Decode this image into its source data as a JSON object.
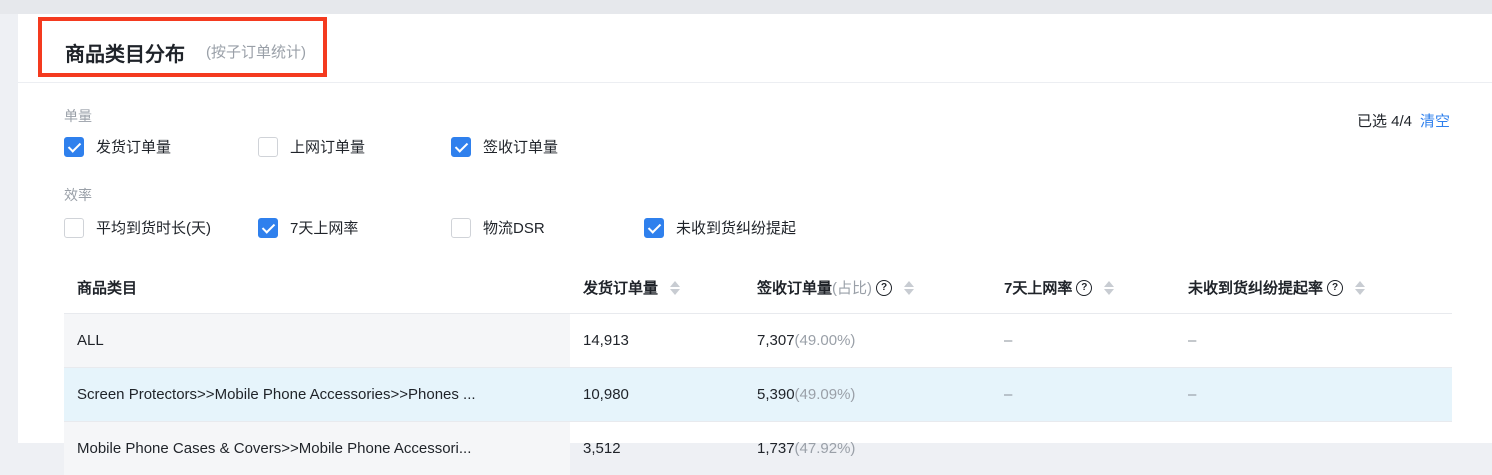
{
  "header": {
    "title": "商品类目分布",
    "subtitle": "(按子订单统计)"
  },
  "filters": {
    "group1_label": "单量",
    "group1": [
      {
        "label": "发货订单量",
        "checked": true
      },
      {
        "label": "上网订单量",
        "checked": false
      },
      {
        "label": "签收订单量",
        "checked": true
      }
    ],
    "group2_label": "效率",
    "group2": [
      {
        "label": "平均到货时长(天)",
        "checked": false
      },
      {
        "label": "7天上网率",
        "checked": true
      },
      {
        "label": "物流DSR",
        "checked": false
      },
      {
        "label": "未收到货纠纷提起",
        "checked": true
      }
    ],
    "selected_text": "已选 4/4",
    "clear_label": "清空"
  },
  "table": {
    "columns": {
      "category": "商品类目",
      "shipped": "发货订单量",
      "signed": "签收订单量",
      "signed_ratio_suffix": "(占比)",
      "online_rate": "7天上网率",
      "dispute_rate": "未收到货纠纷提起率"
    },
    "rows": [
      {
        "category": "ALL",
        "shipped": "14,913",
        "signed": "7,307",
        "signed_pct": "(49.00%)",
        "online_rate": "–",
        "dispute_rate": "–"
      },
      {
        "category": "Screen Protectors>>Mobile Phone Accessories>>Phones ...",
        "shipped": "10,980",
        "signed": "5,390",
        "signed_pct": "(49.09%)",
        "online_rate": "–",
        "dispute_rate": "–"
      },
      {
        "category": "Mobile Phone Cases & Covers>>Mobile Phone Accessori...",
        "shipped": "3,512",
        "signed": "1,737",
        "signed_pct": "(47.92%)",
        "online_rate": "–",
        "dispute_rate": "–"
      }
    ]
  },
  "colors": {
    "accent": "#2f80ed",
    "highlight_border": "#f43a1f",
    "row_highlight": "#e6f4fb"
  }
}
